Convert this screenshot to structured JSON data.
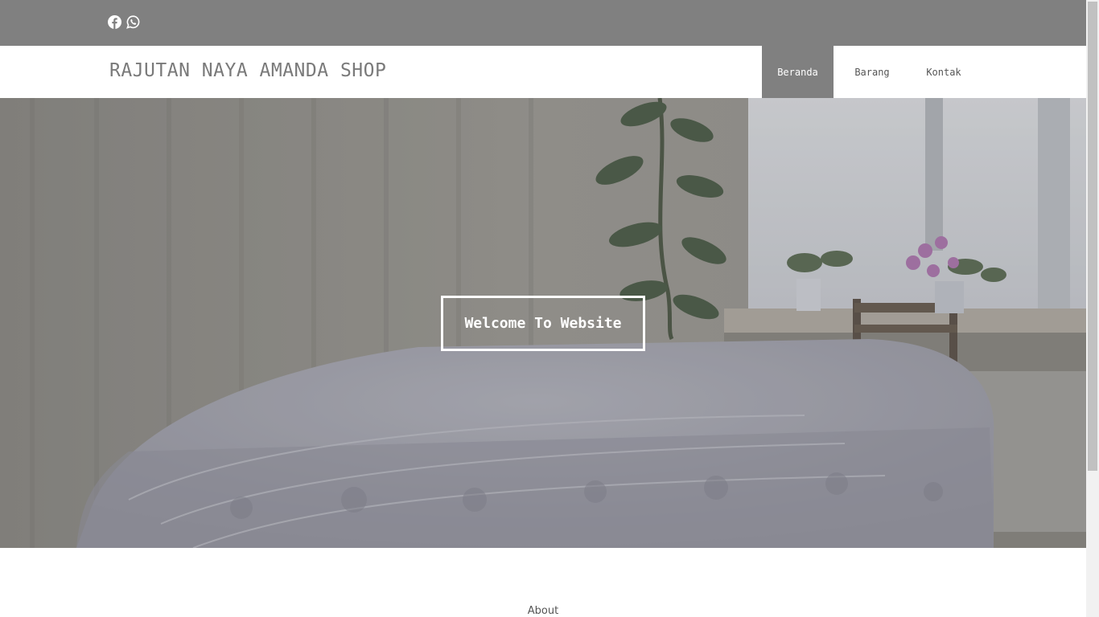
{
  "header": {
    "social_icons": [
      "facebook-icon",
      "whatsapp-icon"
    ],
    "brand": "RAJUTAN NAYA AMANDA SHOP"
  },
  "nav": {
    "items": [
      {
        "label": "Beranda",
        "active": true
      },
      {
        "label": "Barang",
        "active": false
      },
      {
        "label": "Kontak",
        "active": false
      }
    ]
  },
  "hero": {
    "cta_label": "Welcome To Website"
  },
  "about": {
    "title": "About"
  },
  "colors": {
    "topbar": "#808080",
    "nav_active": "#808080",
    "brand_text": "#7a7a7a"
  }
}
